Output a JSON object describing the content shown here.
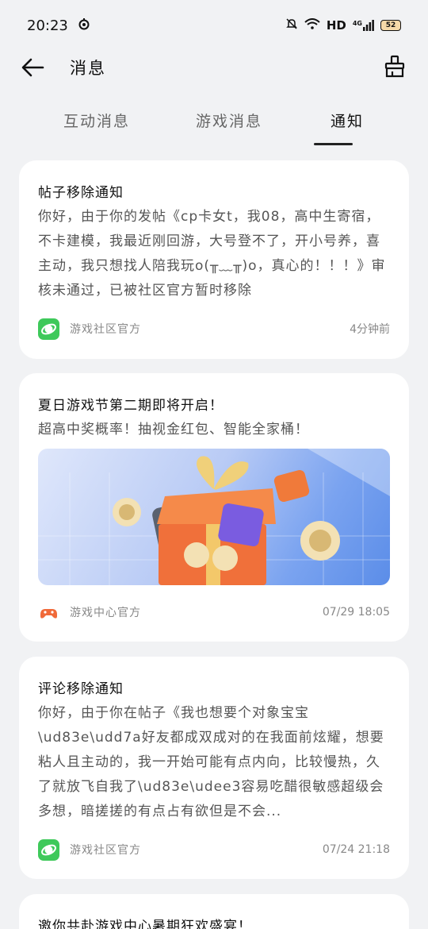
{
  "status": {
    "time": "20:23",
    "network": "HD",
    "signal": "4G",
    "battery": "52"
  },
  "header": {
    "title": "消息"
  },
  "tabs": [
    {
      "label": "互动消息"
    },
    {
      "label": "游戏消息"
    },
    {
      "label": "通知"
    }
  ],
  "cards": [
    {
      "title": "帖子移除通知",
      "body": "你好，由于你的发帖《cp卡女t，我08，高中生寄宿，不卡建模，我最近刚回游，大号登不了，开小号养，喜主动，我只想找人陪我玩o(╥﹏╥)o，真心的！！！》审核未通过，已被社区官方暂时移除",
      "source": "游戏社区官方",
      "time": "4分钟前"
    },
    {
      "title": "夏日游戏节第二期即将开启！",
      "body": "超高中奖概率！抽视金红包、智能全家桶！",
      "source": "游戏中心官方",
      "time": "07/29 18:05"
    },
    {
      "title": "评论移除通知",
      "body": "你好，由于你在帖子《我也想要个对象宝宝\\ud83e\\udd7a好友都成双成对的在我面前炫耀，想要粘人且主动的，我一开始可能有点内向，比较慢热，久了就放飞自我了\\ud83e\\udee3容易吃醋很敏感超级会多想，暗搓搓的有点占有欲但是不会...",
      "source": "游戏社区官方",
      "time": "07/24 21:18"
    },
    {
      "title": "邀你共赴游戏中心暑期狂欢盛宴！"
    }
  ],
  "colors": {
    "community_icon": "#3ec95a",
    "game_center_icon": "#f06a3a"
  }
}
